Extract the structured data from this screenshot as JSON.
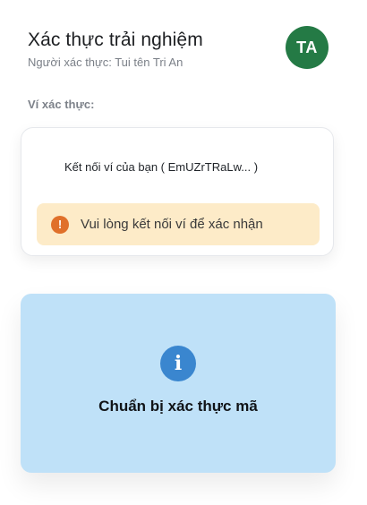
{
  "header": {
    "title": "Xác thực trải nghiệm",
    "subtitle": "Người xác thực: Tui tên Tri An"
  },
  "avatar": {
    "initials": "TA",
    "color": "#247a45"
  },
  "wallet": {
    "section_label": "Ví xác thực:",
    "connect_label": "Kết nối ví của bạn ( EmUZrTRaLw... )",
    "warning": {
      "icon": "exclamation-icon",
      "text": "Vui lòng kết nối ví để xác nhận",
      "background": "#fdebc8",
      "icon_color": "#e0702a"
    }
  },
  "verify": {
    "icon": "info-icon",
    "label": "Chuẩn bị xác thực mã",
    "background": "#bfe1f8",
    "icon_color": "#3a86cf"
  }
}
